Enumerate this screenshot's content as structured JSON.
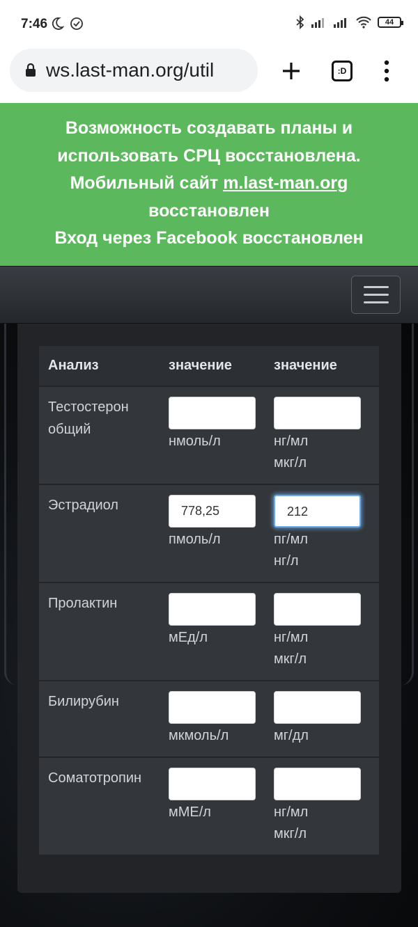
{
  "status_bar": {
    "time": "7:46",
    "battery": "44"
  },
  "browser": {
    "url": "ws.last-man.org/util",
    "tab_label": ":D"
  },
  "announcement": {
    "line1": "Возможность создавать планы и",
    "line2": "использовать СРЦ восстановлена.",
    "line3_prefix": "Мобильный сайт ",
    "line3_link": "m.last-man.org",
    "line4": "восстановлен",
    "line5": "Вход через Facebook восстановлен"
  },
  "table": {
    "headers": [
      "Анализ",
      "значение",
      "значение"
    ],
    "rows": [
      {
        "name_lines": [
          "Тестостерон",
          "общий"
        ],
        "value1": "",
        "value2": "",
        "unit1_lines": [
          "нмоль/л"
        ],
        "unit2_lines": [
          "нг/мл",
          "мкг/л"
        ]
      },
      {
        "name_lines": [
          "Эстрадиол"
        ],
        "value1": "778,25",
        "value2": "212",
        "unit1_lines": [
          "пмоль/л"
        ],
        "unit2_lines": [
          "пг/мл",
          "нг/л"
        ]
      },
      {
        "name_lines": [
          "Пролактин"
        ],
        "value1": "",
        "value2": "",
        "unit1_lines": [
          "мЕд/л"
        ],
        "unit2_lines": [
          "нг/мл",
          "мкг/л"
        ]
      },
      {
        "name_lines": [
          "Билирубин"
        ],
        "value1": "",
        "value2": "",
        "unit1_lines": [
          "мкмоль/л"
        ],
        "unit2_lines": [
          "мг/дл"
        ]
      },
      {
        "name_lines": [
          "Соматотропин"
        ],
        "value1": "",
        "value2": "",
        "unit1_lines": [
          "мМЕ/л"
        ],
        "unit2_lines": [
          "нг/мл",
          "мкг/л"
        ]
      }
    ]
  }
}
